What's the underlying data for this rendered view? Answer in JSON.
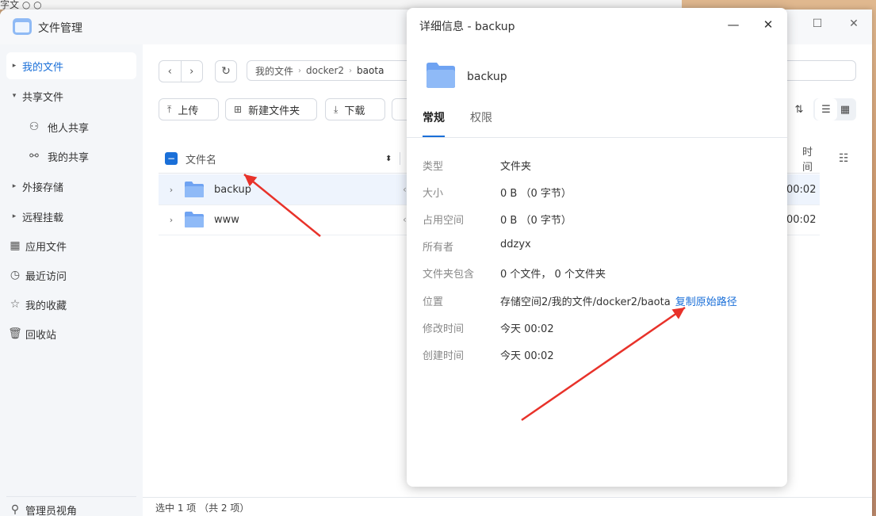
{
  "app": {
    "title": "文件管理",
    "background_fragment": "字文 ○ ○"
  },
  "sidebar": {
    "items": [
      {
        "label": "我的文件",
        "active": true,
        "caret": true
      },
      {
        "label": "共享文件",
        "caret": true,
        "expanded": true
      },
      {
        "label": "他人共享",
        "sub": true,
        "icon": "users-icon"
      },
      {
        "label": "我的共享",
        "sub": true,
        "icon": "share-icon"
      },
      {
        "label": "外接存储",
        "caret": true
      },
      {
        "label": "远程挂载",
        "caret": true
      },
      {
        "label": "应用文件",
        "icon": "apps-icon"
      },
      {
        "label": "最近访问",
        "icon": "clock-icon"
      },
      {
        "label": "我的收藏",
        "icon": "star-icon"
      },
      {
        "label": "回收站",
        "icon": "trash-icon"
      }
    ],
    "footer": "管理员视角"
  },
  "breadcrumb": [
    "我的文件",
    "docker2",
    "baota"
  ],
  "toolbar": {
    "upload": "上传",
    "new_folder": "新建文件夹",
    "download": "下载"
  },
  "table": {
    "col_name": "文件名",
    "col_time": "时间",
    "rows": [
      {
        "name": "backup",
        "time": "00:02",
        "selected": true
      },
      {
        "name": "www",
        "time": "00:02",
        "selected": false
      }
    ]
  },
  "status": "选中 1 项 （共 2 项）",
  "dialog": {
    "title": "详细信息 - backup",
    "name": "backup",
    "tabs": [
      "常规",
      "权限"
    ],
    "properties": [
      {
        "label": "类型",
        "value": "文件夹"
      },
      {
        "label": "大小",
        "value": "0 B （0 字节）"
      },
      {
        "label": "占用空间",
        "value": "0 B （0 字节）"
      },
      {
        "label": "所有者",
        "value": "ddzyx"
      },
      {
        "label": "文件夹包含",
        "value": "0 个文件， 0 个文件夹"
      },
      {
        "label": "位置",
        "value": "存储空间2/我的文件/docker2/baota",
        "link": "复制原始路径"
      },
      {
        "label": "修改时间",
        "value": "今天 00:02"
      },
      {
        "label": "创建时间",
        "value": "今天 00:02"
      }
    ]
  },
  "colors": {
    "accent": "#1a6fd8",
    "folder": "#6fa3f2",
    "annotation_arrow": "#e8322a"
  }
}
